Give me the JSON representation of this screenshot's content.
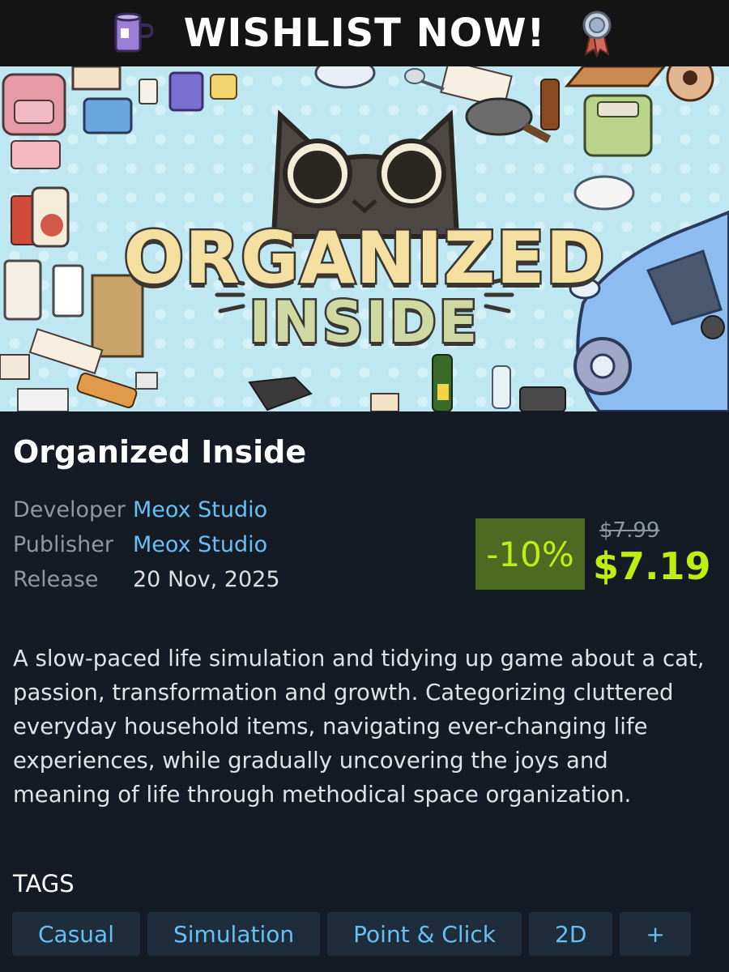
{
  "banner": {
    "text": "WISHLIST NOW!",
    "left_icon": "mug-icon",
    "right_icon": "ribbon-icon"
  },
  "hero": {
    "logo_line1": "ORGANIZED",
    "logo_line2": "INSIDE"
  },
  "game": {
    "title": "Organized Inside",
    "meta": [
      {
        "label": "Developer",
        "value": "Meox Studio",
        "link": true
      },
      {
        "label": "Publisher",
        "value": "Meox Studio",
        "link": true
      },
      {
        "label": "Release",
        "value": "20 Nov, 2025",
        "link": false
      }
    ],
    "price": {
      "discount": "-10%",
      "original": "$7.99",
      "final": "$7.19"
    },
    "description": "A slow-paced life simulation and tidying up game about a cat, passion, transformation and growth. Categorizing cluttered everyday household items, navigating ever-changing life experiences, while gradually uncovering the joys and meaning of life through methodical space organization."
  },
  "tags": {
    "label": "TAGS",
    "items": [
      "Casual",
      "Simulation",
      "Point & Click",
      "2D",
      "+"
    ]
  },
  "colors": {
    "page_bg": "#141b25",
    "link": "#66c0f4",
    "discount_bg": "#4c6b22",
    "discount_text": "#beee11"
  }
}
